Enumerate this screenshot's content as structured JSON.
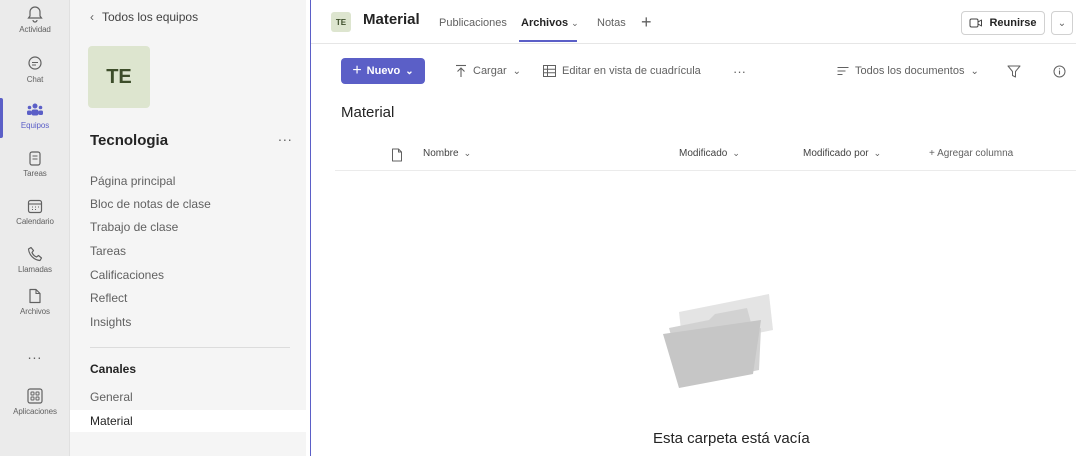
{
  "rail": {
    "items": [
      {
        "label": "Actividad",
        "icon": "bell-icon"
      },
      {
        "label": "Chat",
        "icon": "chat-icon"
      },
      {
        "label": "Equipos",
        "icon": "teams-icon"
      },
      {
        "label": "Tareas",
        "icon": "assignments-icon"
      },
      {
        "label": "Calendario",
        "icon": "calendar-icon"
      },
      {
        "label": "Llamadas",
        "icon": "phone-icon"
      },
      {
        "label": "Archivos",
        "icon": "file-icon"
      }
    ],
    "more": "...",
    "apps": {
      "label": "Aplicaciones",
      "icon": "apps-icon"
    },
    "accent": "#5b5fc7"
  },
  "team": {
    "back_label": "Todos los equipos",
    "avatar": "TE",
    "name": "Tecnologia",
    "more": "...",
    "nav": [
      "Página principal",
      "Bloc de notas de clase",
      "Trabajo de clase",
      "Tareas",
      "Calificaciones",
      "Reflect",
      "Insights"
    ],
    "channels_header": "Canales",
    "channels": [
      "General",
      "Material"
    ],
    "selected_channel": "Material"
  },
  "header": {
    "badge": "TE",
    "title": "Material",
    "tabs": [
      {
        "label": "Publicaciones"
      },
      {
        "label": "Archivos"
      },
      {
        "label": "Notas"
      }
    ],
    "active_tab": "Archivos",
    "meet_label": "Reunirse"
  },
  "toolbar": {
    "new_label": "Nuevo",
    "upload_label": "Cargar",
    "grid_label": "Editar en vista de cuadrícula",
    "more": "···",
    "view_label": "Todos los documentos"
  },
  "files": {
    "folder_title": "Material",
    "columns": [
      "Nombre",
      "Modificado",
      "Modificado por"
    ],
    "add_column": "+ Agregar columna",
    "empty_message": "Esta carpeta está vacía"
  }
}
